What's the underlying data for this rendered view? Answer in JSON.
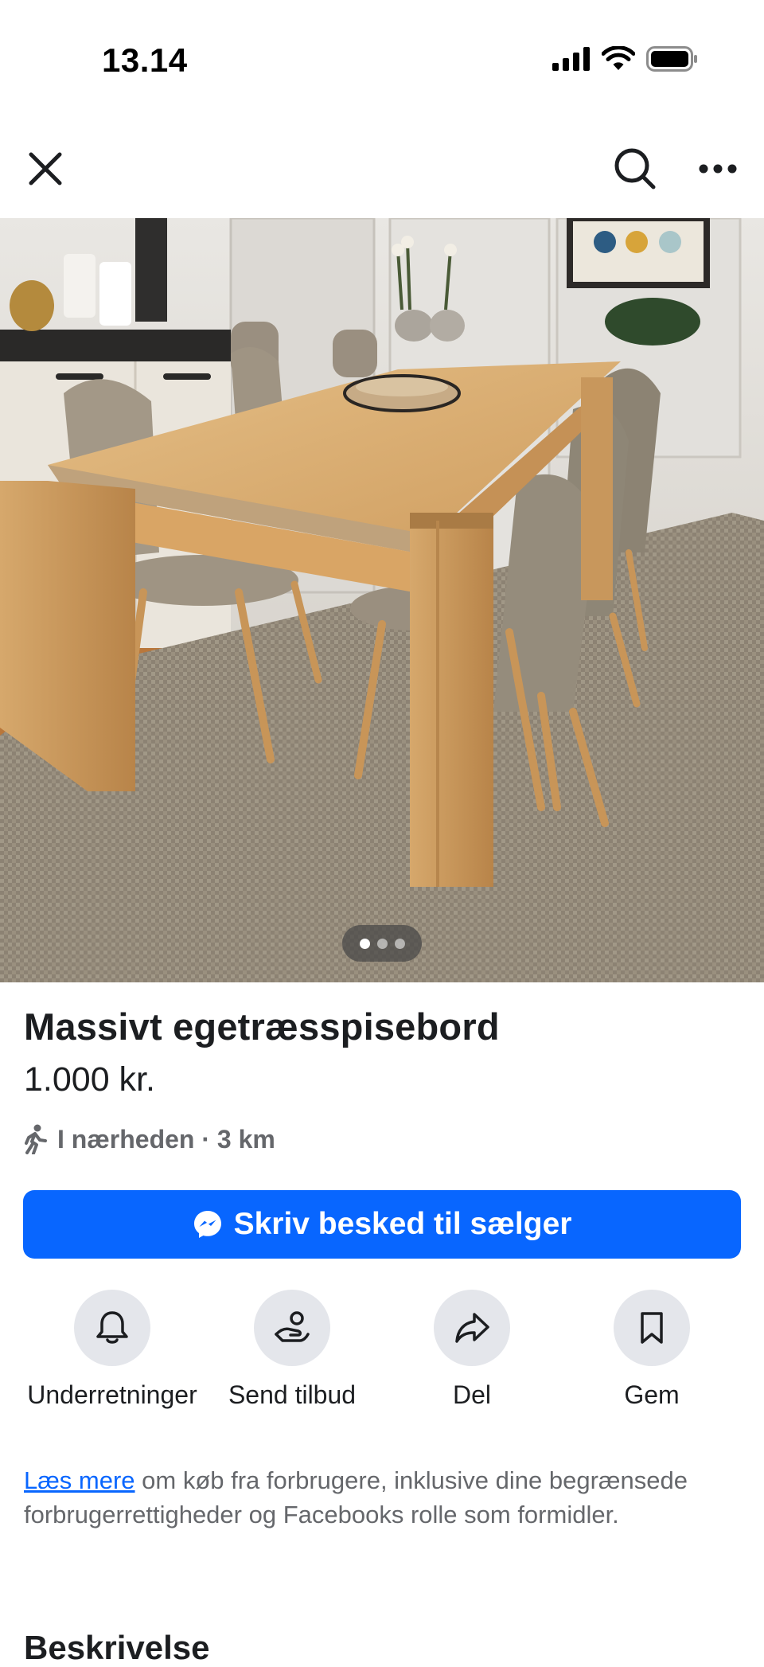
{
  "status_bar": {
    "time": "13.14",
    "signal_icon": "cellular-signal-icon",
    "wifi_icon": "wifi-icon",
    "battery_icon": "battery-icon"
  },
  "top_nav": {
    "close_icon": "close-icon",
    "search_icon": "search-icon",
    "more_icon": "more-options-icon"
  },
  "gallery": {
    "photo_count": 3,
    "active_index": 1
  },
  "listing": {
    "title": "Massivt egetræsspisebord",
    "price": "1.000 kr.",
    "location": "I nærheden · 3 km",
    "location_icon": "walking-person-icon"
  },
  "message_button": {
    "label": "Skriv besked til sælger",
    "icon": "messenger-icon"
  },
  "actions": [
    {
      "label": "Underretninger",
      "icon": "bell-icon"
    },
    {
      "label": "Send tilbud",
      "icon": "offer-hand-icon"
    },
    {
      "label": "Del",
      "icon": "share-arrow-icon"
    },
    {
      "label": "Gem",
      "icon": "bookmark-icon"
    }
  ],
  "notice": {
    "link_text": "Læs mere",
    "text": " om køb fra forbrugere, inklusive dine begrænsede forbrugerrettigheder og Facebooks rolle som formidler."
  },
  "description": {
    "heading": "Beskrivelse"
  },
  "colors": {
    "accent": "#0866ff",
    "secondary_text": "#65676b",
    "action_circle": "#e4e6eb"
  }
}
